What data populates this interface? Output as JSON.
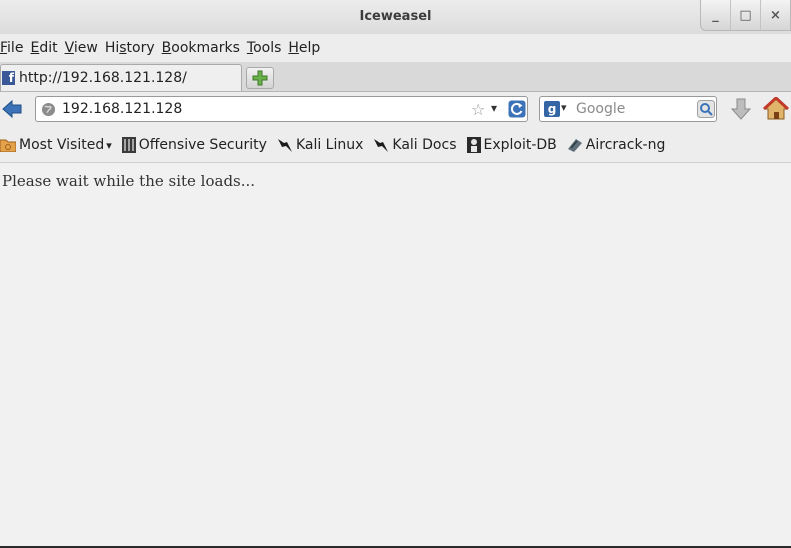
{
  "window": {
    "title": "Iceweasel",
    "controls": [
      "_",
      "□",
      "×"
    ]
  },
  "menubar": {
    "items": [
      {
        "pre": "",
        "u": "F",
        "post": "ile"
      },
      {
        "pre": "",
        "u": "E",
        "post": "dit"
      },
      {
        "pre": "",
        "u": "V",
        "post": "iew"
      },
      {
        "pre": "Hi",
        "u": "s",
        "post": "tory"
      },
      {
        "pre": "",
        "u": "B",
        "post": "ookmarks"
      },
      {
        "pre": "",
        "u": "T",
        "post": "ools"
      },
      {
        "pre": "",
        "u": "H",
        "post": "elp"
      }
    ]
  },
  "tabs": [
    {
      "label": "http://192.168.121.128/",
      "favicon": "facebook-icon",
      "favicon_glyph": "f",
      "active": true
    }
  ],
  "navbar": {
    "url": "192.168.121.128",
    "search_placeholder": "Google",
    "search_engine_glyph": "g"
  },
  "bookmarks": [
    {
      "label": "Most Visited",
      "icon": "folder-icon",
      "has_caret": true
    },
    {
      "label": "Offensive Security",
      "icon": "offsec-icon"
    },
    {
      "label": "Kali Linux",
      "icon": "kali-dragon-icon"
    },
    {
      "label": "Kali Docs",
      "icon": "kali-dragon-icon"
    },
    {
      "label": "Exploit-DB",
      "icon": "exploitdb-icon"
    },
    {
      "label": "Aircrack-ng",
      "icon": "aircrack-icon"
    }
  ],
  "content": {
    "message": "Please wait while the site loads..."
  },
  "colors": {
    "accent_blue": "#3465a4",
    "facebook_blue": "#3b5998"
  }
}
